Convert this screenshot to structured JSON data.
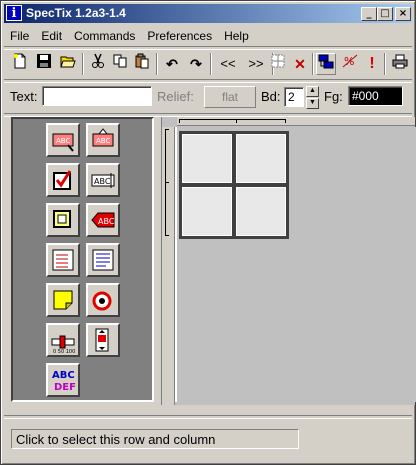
{
  "window": {
    "title": "SpecTix 1.2a3-1.4",
    "icon_letter": "i",
    "min_glyph": "_",
    "max_glyph": "□",
    "close_glyph": "×"
  },
  "menu": [
    "File",
    "Edit",
    "Commands",
    "Preferences",
    "Help"
  ],
  "toolbar": {
    "new_icon": "new-file-icon",
    "save_icon": "floppy-disk-icon",
    "open_icon": "folder-open-icon",
    "cut_icon": "scissors-icon",
    "copy_icon": "copy-icon",
    "paste_icon": "paste-icon",
    "undo_glyph": "↶",
    "redo_glyph": "↷",
    "prev_label": "<<",
    "next_label": ">>",
    "delete_glyph": "✕",
    "exclaim_label": "!"
  },
  "props": {
    "text_label": "Text:",
    "text_value": "",
    "relief_label": "Relief:",
    "relief_value": "flat",
    "bd_label": "Bd:",
    "bd_value": "2",
    "fg_label": "Fg:",
    "fg_value": "#000"
  },
  "palette": {
    "widgets": [
      "button-widget-icon",
      "menubutton-widget-icon",
      "checkbutton-widget-icon",
      "entry-widget-icon",
      "frame-widget-icon",
      "label-widget-icon",
      "listbox-widget-icon",
      "message-widget-icon",
      "note-widget-icon",
      "radiobutton-widget-icon",
      "scale-widget-icon",
      "scrollbar-widget-icon",
      "text-widget-icon"
    ],
    "abc_text": "ABC",
    "def_text": "DEF"
  },
  "status": {
    "text": "Click to select this row and column"
  },
  "colors": {
    "title_start": "#0a246a",
    "title_end": "#a6caf0",
    "face": "#d4d0c8",
    "palette_bg": "#808080",
    "canvas_bg": "#c0c0c0"
  }
}
